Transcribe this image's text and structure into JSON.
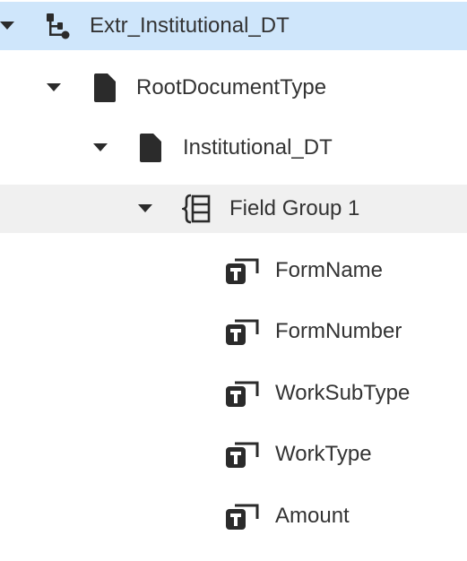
{
  "tree": {
    "root": {
      "label": "Extr_Institutional_DT",
      "icon": "hierarchy-icon",
      "expanded": true,
      "selected": true
    },
    "doc_type": {
      "label": "RootDocumentType",
      "icon": "document-icon",
      "expanded": true
    },
    "sub_doc_type": {
      "label": "Institutional_DT",
      "icon": "document-icon",
      "expanded": true
    },
    "field_group": {
      "label": "Field Group 1",
      "icon": "field-group-icon",
      "expanded": true
    },
    "fields": [
      {
        "label": "FormName",
        "icon": "text-field-icon"
      },
      {
        "label": "FormNumber",
        "icon": "text-field-icon"
      },
      {
        "label": "WorkSubType",
        "icon": "text-field-icon"
      },
      {
        "label": "WorkType",
        "icon": "text-field-icon"
      },
      {
        "label": "Amount",
        "icon": "text-field-icon"
      }
    ]
  },
  "colors": {
    "selected_row": "#cfe6fb",
    "hover_row": "#f0f0f0",
    "icon": "#2b2b2b",
    "text": "#333333"
  }
}
